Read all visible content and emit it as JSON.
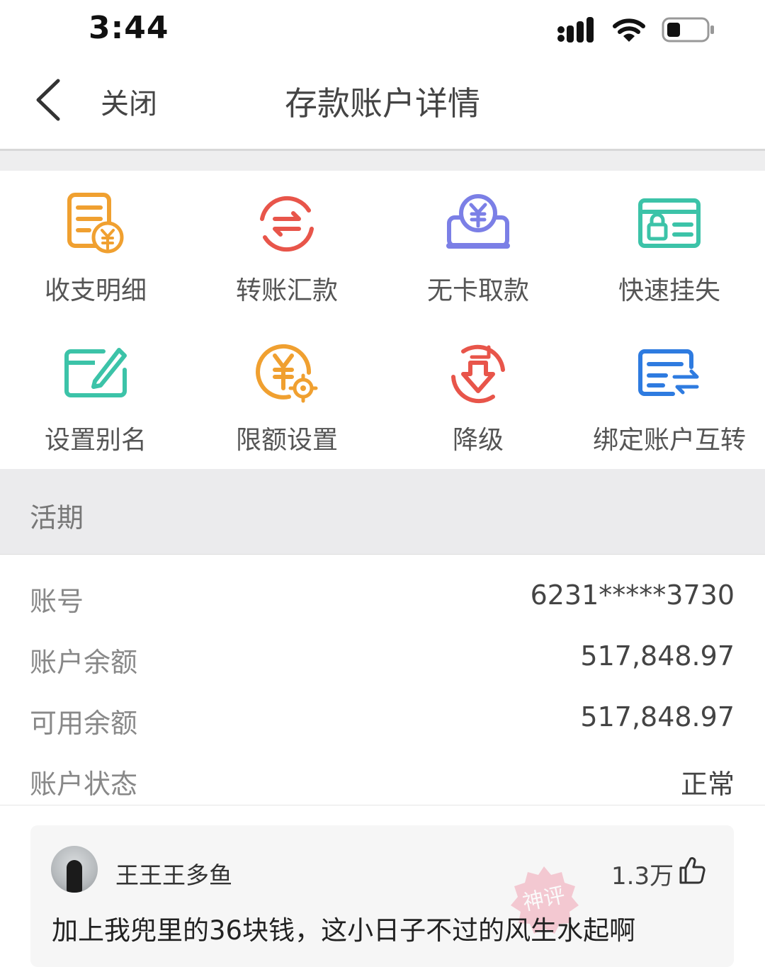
{
  "status_bar": {
    "time": "3:44",
    "icons": [
      "cellular-signal-icon",
      "wifi-icon",
      "battery-icon"
    ]
  },
  "nav": {
    "back_icon": "chevron-left-icon",
    "close_label": "关闭",
    "title": "存款账户详情"
  },
  "actions": [
    {
      "label": "收支明细",
      "icon": "statement-icon",
      "color": "#F0A030"
    },
    {
      "label": "转账汇款",
      "icon": "transfer-icon",
      "color": "#E8554A"
    },
    {
      "label": "无卡取款",
      "icon": "cardless-withdraw-icon",
      "color": "#7B7FE6"
    },
    {
      "label": "快速挂失",
      "icon": "report-loss-icon",
      "color": "#3CC3A8"
    },
    {
      "label": "设置别名",
      "icon": "edit-alias-icon",
      "color": "#3CC3A8"
    },
    {
      "label": "限额设置",
      "icon": "limit-settings-icon",
      "color": "#F0A030"
    },
    {
      "label": "降级",
      "icon": "downgrade-icon",
      "color": "#E8554A"
    },
    {
      "label": "绑定账户互转",
      "icon": "bound-account-transfer-icon",
      "color": "#2E7BE0"
    }
  ],
  "section": {
    "title": "活期"
  },
  "account": [
    {
      "key": "账号",
      "value": "6231*****3730"
    },
    {
      "key": "账户余额",
      "value": "517,848.97"
    },
    {
      "key": "可用余额",
      "value": "517,848.97"
    },
    {
      "key": "账户状态",
      "value": "正常"
    }
  ],
  "comment": {
    "username": "王王王多鱼",
    "likes": "1.3万",
    "text": "加上我兜里的36块钱，这小日子不过的风生水起啊",
    "stamp_text": "神评"
  }
}
